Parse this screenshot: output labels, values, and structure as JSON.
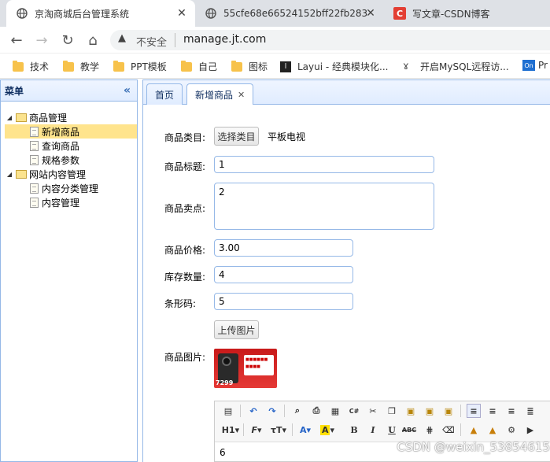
{
  "browser": {
    "tabs": [
      {
        "title": "京淘商城后台管理系统",
        "active": true
      },
      {
        "title": "55cfe68e66524152bff22fb283",
        "active": false
      },
      {
        "title": "写文章-CSDN博客",
        "active": false
      }
    ],
    "security_label": "不安全",
    "url": "manage.jt.com",
    "bookmarks": [
      "技术",
      "教学",
      "PPT模板",
      "自己",
      "图标",
      "Layui - 经典模块化...",
      "开启MySQL远程访...",
      "Pr"
    ]
  },
  "menu": {
    "title": "菜单",
    "tree": [
      {
        "label": "商品管理",
        "children": [
          "新增商品",
          "查询商品",
          "规格参数"
        ]
      },
      {
        "label": "网站内容管理",
        "children": [
          "内容分类管理",
          "内容管理"
        ]
      }
    ],
    "selected": "新增商品"
  },
  "content_tabs": [
    {
      "label": "首页"
    },
    {
      "label": "新增商品",
      "closable": true
    }
  ],
  "form": {
    "category_label": "商品类目:",
    "category_button": "选择类目",
    "category_value": "平板电视",
    "title_label": "商品标题:",
    "title_value": "1",
    "sellpoint_label": "商品卖点:",
    "sellpoint_value": "2",
    "price_label": "商品价格:",
    "price_value": "3.00",
    "stock_label": "库存数量:",
    "stock_value": "4",
    "barcode_label": "条形码:",
    "barcode_value": "5",
    "upload_button": "上传图片",
    "image_label": "商品图片:",
    "image_price": "7299"
  },
  "editor": {
    "content": "6",
    "tools_row1": [
      "source-icon",
      "undo-icon",
      "redo-icon",
      "preview-icon",
      "print-icon",
      "template-icon",
      "code-icon",
      "cut-icon",
      "copy-icon",
      "paste-icon",
      "paste-text-icon",
      "paste-word-icon",
      "align-left-icon",
      "align-center-icon",
      "align-right-icon",
      "align-justify-icon"
    ],
    "tools_row2": [
      "H1",
      "F",
      "T",
      "A",
      "A",
      "B",
      "I",
      "U",
      "ABC"
    ]
  },
  "watermark": "CSDN @weixin_53854615"
}
